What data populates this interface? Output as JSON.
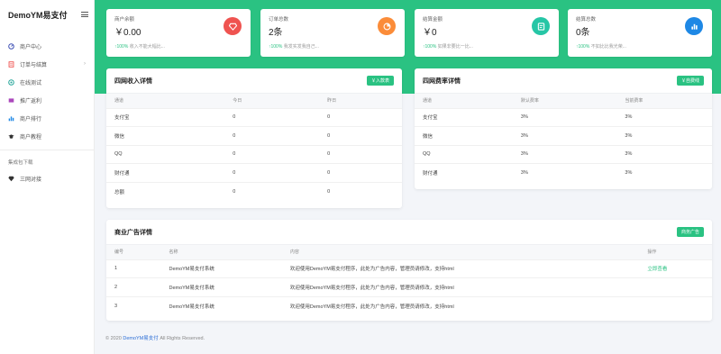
{
  "sidebar": {
    "brand": "DemoYM易支付",
    "items": [
      {
        "label": "商户中心",
        "icon": "dashboard-icon"
      },
      {
        "label": "订单与结算",
        "icon": "orders-icon"
      },
      {
        "label": "在线测试",
        "icon": "test-icon"
      },
      {
        "label": "推广返利",
        "icon": "promotion-icon"
      },
      {
        "label": "商户排行",
        "icon": "ranking-icon"
      },
      {
        "label": "商户教程",
        "icon": "tutorial-icon"
      }
    ],
    "section_label": "集成包下载",
    "extra_item": {
      "label": "三网对接",
      "icon": "diamond-icon"
    }
  },
  "stats": [
    {
      "label": "商户余额",
      "value": "￥0.00",
      "note_up": "↑100%",
      "note": "收入不能大幅比...",
      "color": "#ef5350",
      "icon": "gem-icon"
    },
    {
      "label": "订单总数",
      "value": "2条",
      "note_up": "↑100%",
      "note": "我发实发我自己...",
      "color": "#fb8c39",
      "icon": "chart-pie-icon"
    },
    {
      "label": "结算金额",
      "value": "￥0",
      "note_up": "↑100%",
      "note": "如果非要比一比...",
      "color": "#26c6a6",
      "icon": "wallet-icon"
    },
    {
      "label": "结算总数",
      "value": "0条",
      "note_up": "↑100%",
      "note": "不如比比我光荣...",
      "color": "#1e88e5",
      "icon": "bar-chart-icon"
    }
  ],
  "income": {
    "title": "四网收入详情",
    "button": "￥入款表",
    "headers": [
      "通道",
      "今日",
      "昨日"
    ],
    "rows": [
      [
        "支付宝",
        "0",
        "0"
      ],
      [
        "微信",
        "0",
        "0"
      ],
      [
        "QQ",
        "0",
        "0"
      ],
      [
        "财付通",
        "0",
        "0"
      ],
      [
        "总额",
        "0",
        "0"
      ]
    ]
  },
  "rates": {
    "title": "四网费率详情",
    "button": "￥自费线",
    "headers": [
      "通道",
      "默认费率",
      "当前费率"
    ],
    "rows": [
      [
        "支付宝",
        "3%",
        "3%"
      ],
      [
        "微信",
        "3%",
        "3%"
      ],
      [
        "QQ",
        "3%",
        "3%"
      ],
      [
        "财付通",
        "3%",
        "3%"
      ]
    ]
  },
  "ads": {
    "title": "商业广告详情",
    "button": "商务广告",
    "headers": [
      "编号",
      "名称",
      "内容",
      "操作"
    ],
    "rows": [
      [
        "1",
        "DemoYM易支付系统",
        "欢迎使用DemoYM易支付程序，此处为广告内容，管理员请修改，支持html",
        "立即查看"
      ],
      [
        "2",
        "DemoYM易支付系统",
        "欢迎使用DemoYM易支付程序，此处为广告内容，管理员请修改，支持html",
        ""
      ],
      [
        "3",
        "DemoYM易支付系统",
        "欢迎使用DemoYM易支付程序，此处为广告内容，管理员请修改，支持html",
        ""
      ]
    ]
  },
  "footer": {
    "prefix": "© 2020",
    "brand": "DemoYM易支付",
    "suffix": "All Rights Reserved."
  },
  "colors": {
    "accent": "#2ac282"
  }
}
